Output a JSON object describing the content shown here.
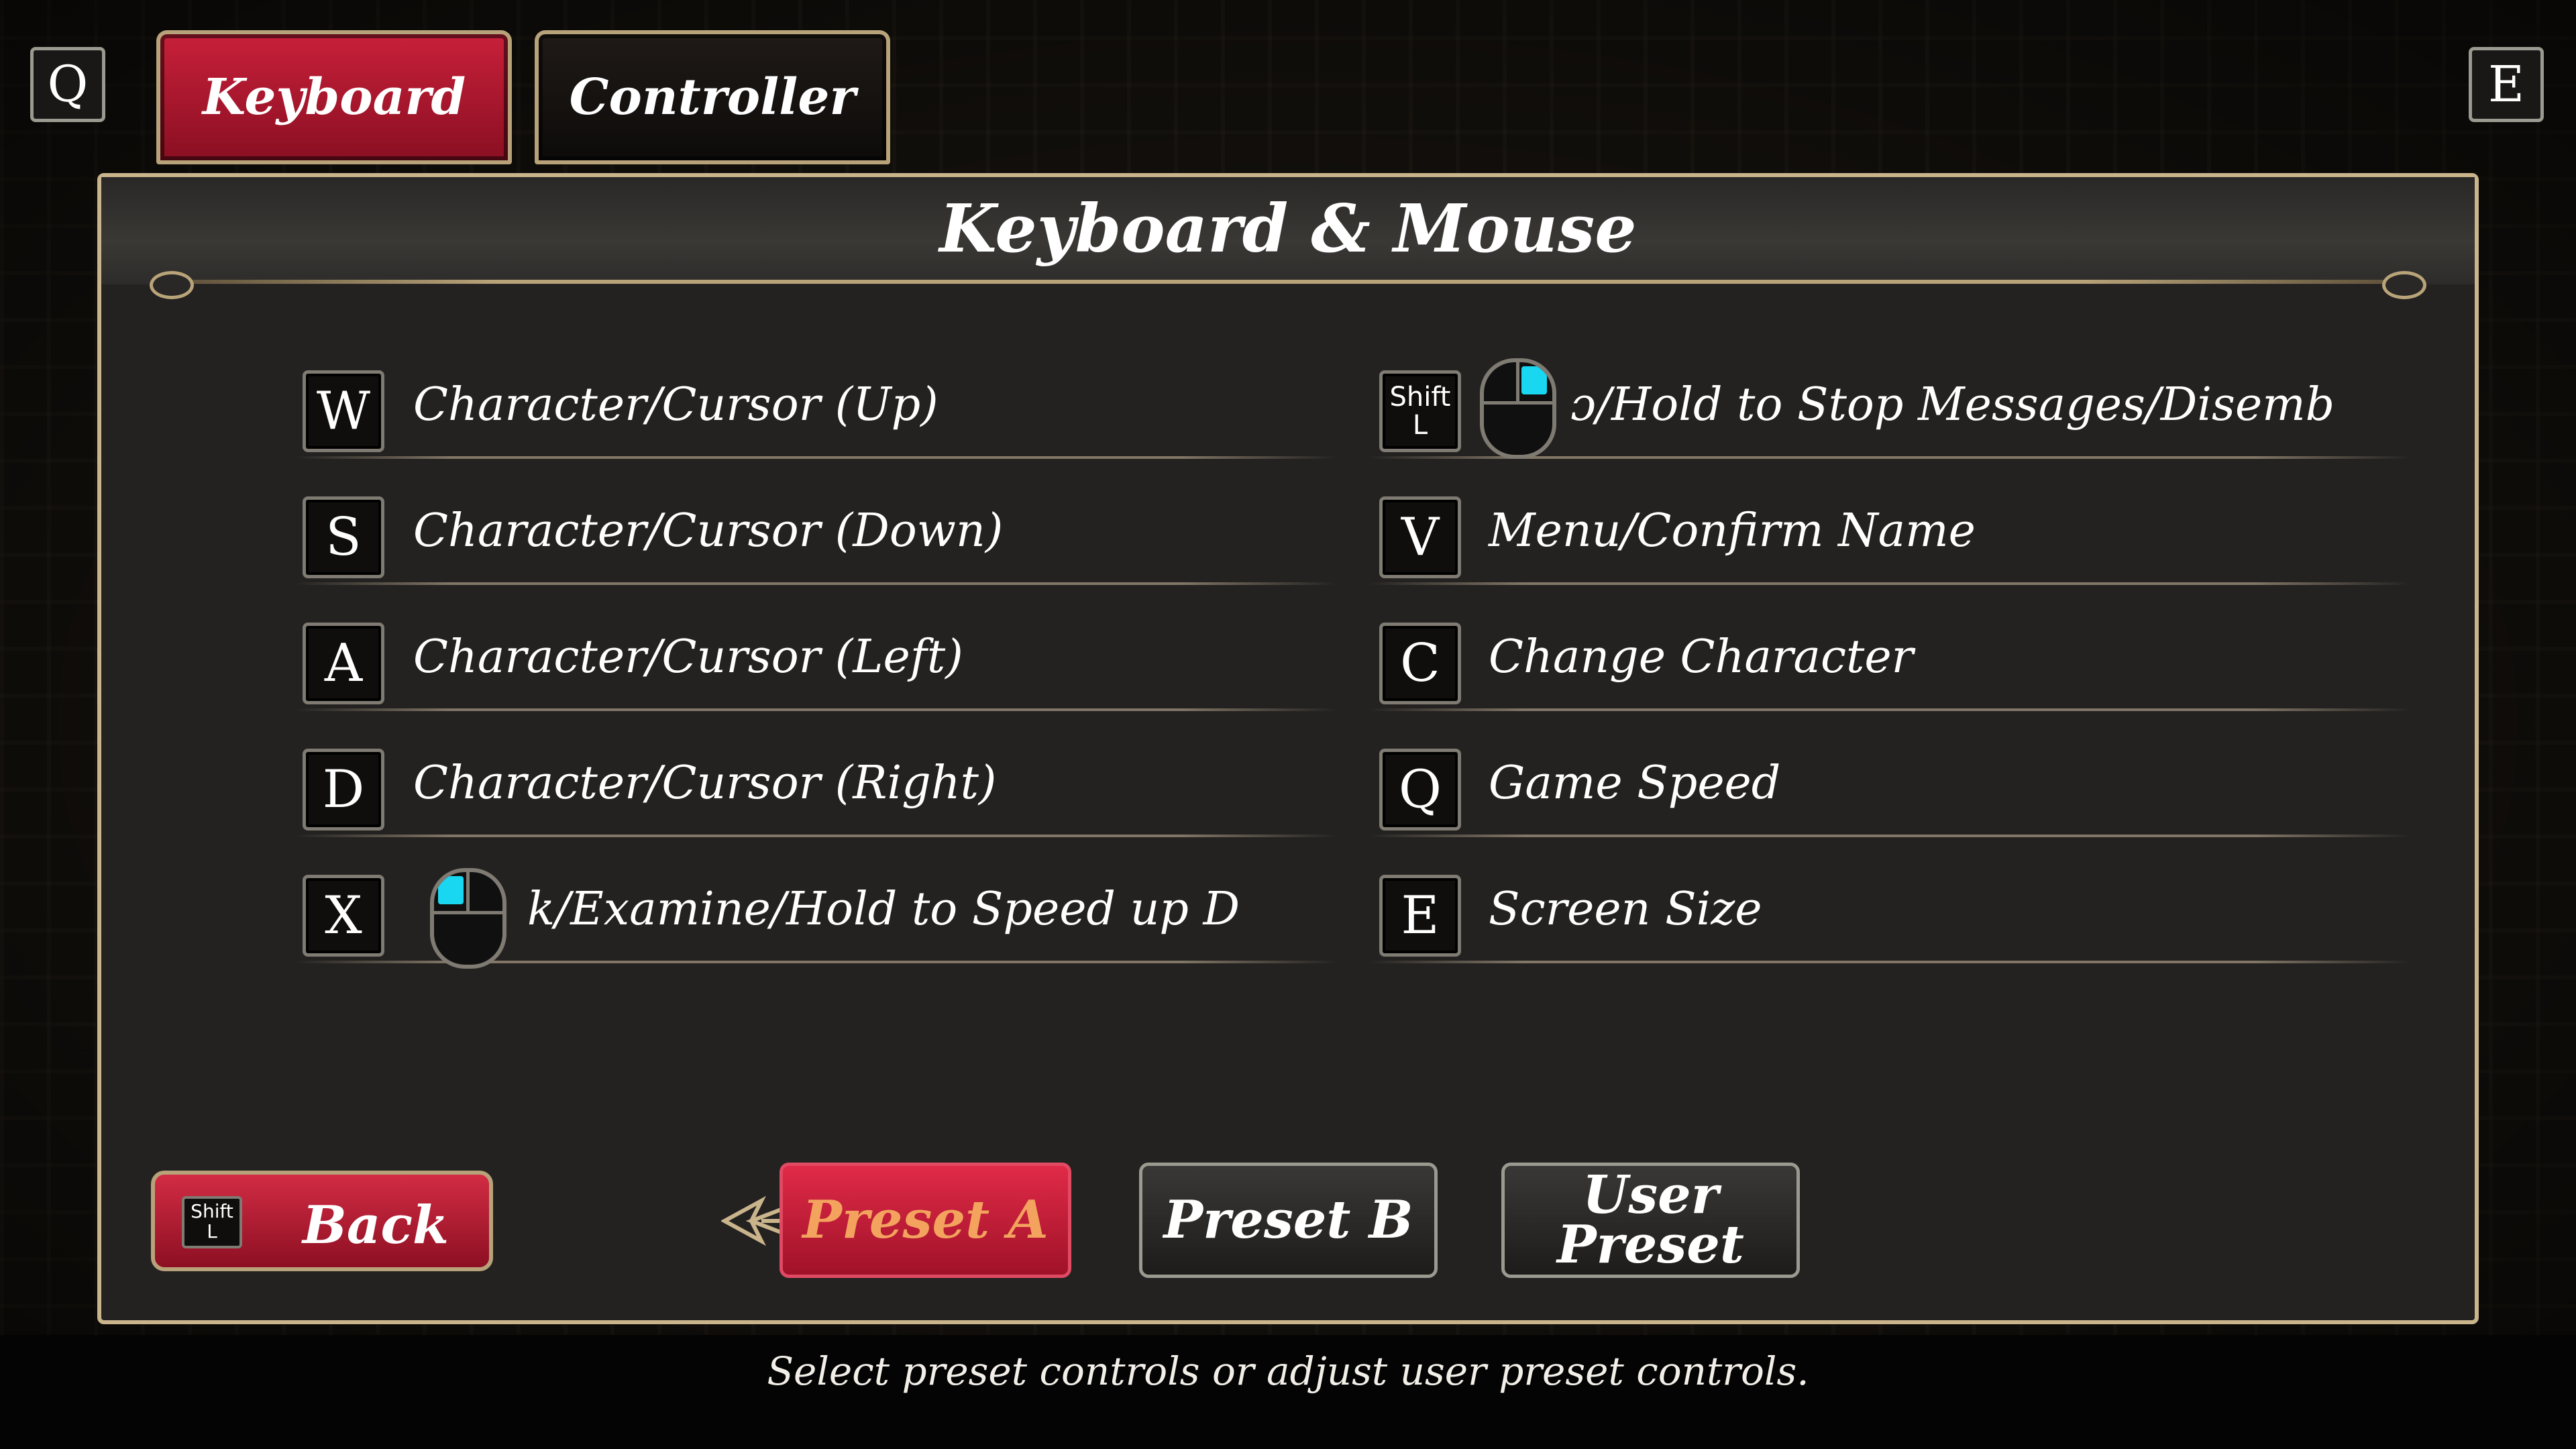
{
  "top_hints": {
    "left_key": "Q",
    "right_key": "E"
  },
  "tabs": [
    {
      "label": "Keyboard",
      "active": true
    },
    {
      "label": "Controller",
      "active": false
    }
  ],
  "panel": {
    "title": "Keyboard & Mouse",
    "left_column": [
      {
        "key": "W",
        "action": "Character/Cursor (Up)"
      },
      {
        "key": "S",
        "action": "Character/Cursor (Down)"
      },
      {
        "key": "A",
        "action": "Character/Cursor (Left)"
      },
      {
        "key": "D",
        "action": "Character/Cursor (Right)"
      },
      {
        "key": "X",
        "mouse": "left-click",
        "action": "k/Examine/Hold to Speed up Dialo"
      }
    ],
    "right_column": [
      {
        "key_top": "Shift",
        "key_bottom": "L",
        "mouse": "right-click",
        "action": "ɔ/Hold to Stop Messages/Disembar"
      },
      {
        "key": "V",
        "action": "Menu/Confirm Name"
      },
      {
        "key": "C",
        "action": "Change Character"
      },
      {
        "key": "Q",
        "action": "Game Speed"
      },
      {
        "key": "E",
        "action": "Screen Size"
      }
    ]
  },
  "back_button": {
    "label": "Back",
    "key_top": "Shift",
    "key_bottom": "L"
  },
  "presets": [
    {
      "label": "Preset A",
      "selected": true
    },
    {
      "label": "Preset B",
      "selected": false
    },
    {
      "label": "User Preset",
      "selected": false
    }
  ],
  "footer_hint": "Select preset controls or adjust user preset controls.",
  "colors": {
    "accent_red": "#c8203a",
    "gold_border": "#c9b48c",
    "mouse_highlight": "#19d7f0",
    "selected_text": "#f3a35e"
  }
}
